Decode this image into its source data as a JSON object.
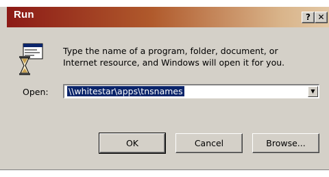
{
  "window": {
    "title": "Run",
    "help_label": "?",
    "close_label": "✕"
  },
  "dialog": {
    "message_line1": "Type the name of a program, folder, document, or",
    "message_line2": "Internet resource, and Windows will open it for you.",
    "open_label": "Open:",
    "open_value": "\\\\whitestar\\apps\\tnsnames",
    "dropdown_arrow": "▼"
  },
  "buttons": {
    "ok": "OK",
    "cancel": "Cancel",
    "browse": "Browse..."
  },
  "colors": {
    "title_start": "#8c1a16",
    "title_end": "#e2c8a5",
    "face": "#d4d0c8",
    "selection": "#0a246a"
  },
  "icons": {
    "app": "run-hourglass-window-icon",
    "dropdown": "chevron-down-icon",
    "help": "help-icon",
    "close": "close-icon"
  }
}
